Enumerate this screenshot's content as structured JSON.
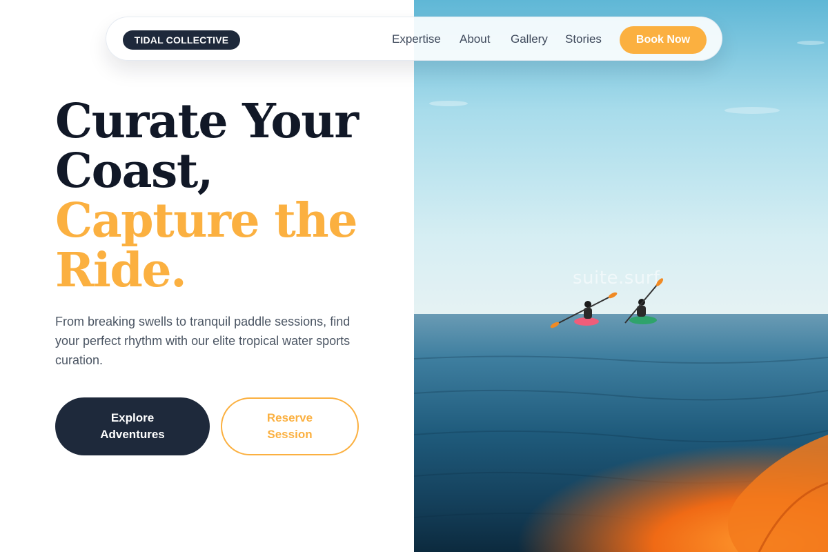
{
  "nav": {
    "brand": "TIDAL COLLECTIVE",
    "links": [
      "Expertise",
      "About",
      "Gallery",
      "Stories"
    ],
    "cta": "Book Now"
  },
  "hero": {
    "title_line1": "Curate Your",
    "title_line2": "Coast,",
    "accent_line1": "Capture the",
    "accent_line2": "Ride.",
    "subtitle": "From breaking swells to tranquil paddle sessions, find your perfect rhythm with our elite tropical water sports curation.",
    "primary_button": "Explore Adventures",
    "secondary_button": "Reserve Session"
  },
  "photo": {
    "watermark": "suite.surf"
  },
  "colors": {
    "accent": "#fbb040",
    "navy": "#1e293b",
    "heading": "#111827",
    "body_text": "#4b5563"
  }
}
